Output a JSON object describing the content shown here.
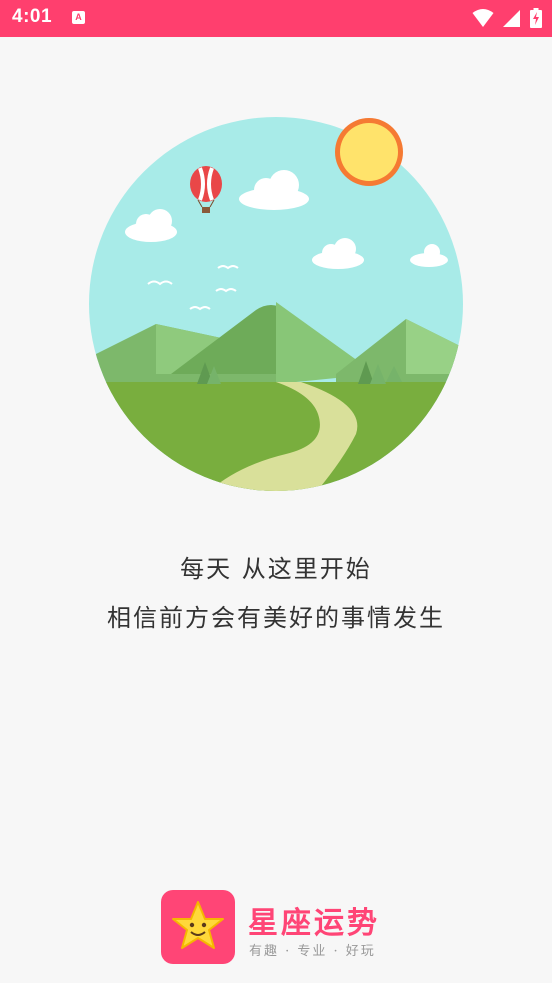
{
  "status_bar": {
    "time": "4:01",
    "notification_icon_letter": "A",
    "icons": [
      "wifi-icon",
      "signal-icon",
      "battery-charging-icon"
    ],
    "background_color": "#ff3f6e"
  },
  "illustration": {
    "subject": "landscape-circle",
    "elements": [
      "sun-icon",
      "hot-air-balloon-icon",
      "cloud-icon",
      "bird-icon",
      "mountain-icon",
      "tree-icon",
      "path-icon"
    ]
  },
  "slogan": {
    "line1": "每天  从这里开始",
    "line2": "相信前方会有美好的事情发生"
  },
  "brand": {
    "name": "星座运势",
    "tagline": "有趣 · 专业 · 好玩",
    "accent_color": "#ff4576"
  }
}
